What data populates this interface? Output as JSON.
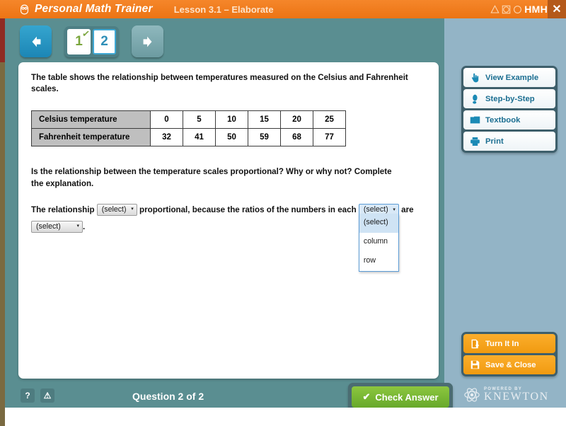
{
  "header": {
    "app_title": "Personal Math Trainer",
    "lesson": "Lesson 3.1 – Elaborate",
    "brand": "HMH",
    "close_label": "✕",
    "logo_icon": "owl-icon",
    "brand_shapes": [
      "triangle-outline",
      "circle-in-square-outline",
      "circle-outline"
    ]
  },
  "nav": {
    "prev_label": "◀",
    "next_label": "▶",
    "pages": [
      {
        "label": "1",
        "state": "done",
        "check": "✓"
      },
      {
        "label": "2",
        "state": "active",
        "check": ""
      }
    ]
  },
  "content": {
    "prompt": "The table shows the relationship between temperatures measured on the Celsius and Fahrenheit scales.",
    "table": {
      "rows": [
        {
          "header": "Celsius temperature",
          "values": [
            "0",
            "5",
            "10",
            "15",
            "20",
            "25"
          ]
        },
        {
          "header": "Fahrenheit temperature",
          "values": [
            "32",
            "41",
            "50",
            "59",
            "68",
            "77"
          ]
        }
      ]
    },
    "question": "Is the relationship between the temperature scales proportional? Why or why not? Complete the explanation.",
    "answer": {
      "text_1": "The relationship",
      "select_1": {
        "value": "(select)",
        "caret": "▾"
      },
      "text_2": "proportional, because the ratios of the numbers in each",
      "select_2": {
        "value": "(select)",
        "caret": "▾",
        "open": true,
        "options": [
          "(select)",
          "column",
          "row"
        ]
      },
      "text_3": "are",
      "select_3": {
        "value": "(select)",
        "caret": "▾"
      },
      "text_4": "."
    }
  },
  "tools": [
    {
      "label": "View Example",
      "icon": "pointing-hand-icon"
    },
    {
      "label": "Step-by-Step",
      "icon": "footprint-icon"
    },
    {
      "label": "Textbook",
      "icon": "book-icon"
    },
    {
      "label": "Print",
      "icon": "printer-icon"
    }
  ],
  "actions": [
    {
      "label": "Turn It In",
      "icon": "upload-document-icon"
    },
    {
      "label": "Save & Close",
      "icon": "floppy-disk-icon"
    }
  ],
  "footer": {
    "help_label": "?",
    "alert_label": "⚠",
    "question_status": "Question 2 of 2",
    "check_answer": "Check Answer",
    "check_tick": "✔",
    "knewton_powered": "POWERED BY",
    "knewton_name": "KNEWTON",
    "knewton_icon": "atom-icon"
  },
  "colors": {
    "header_orange": "#ec7414",
    "teal": "#5a8e91",
    "panel_blue": "#93b4c6",
    "accent_blue": "#1b8ab5",
    "green": "#7aa53c",
    "action_orange": "#f09a10",
    "check_green": "#8cc63f"
  }
}
